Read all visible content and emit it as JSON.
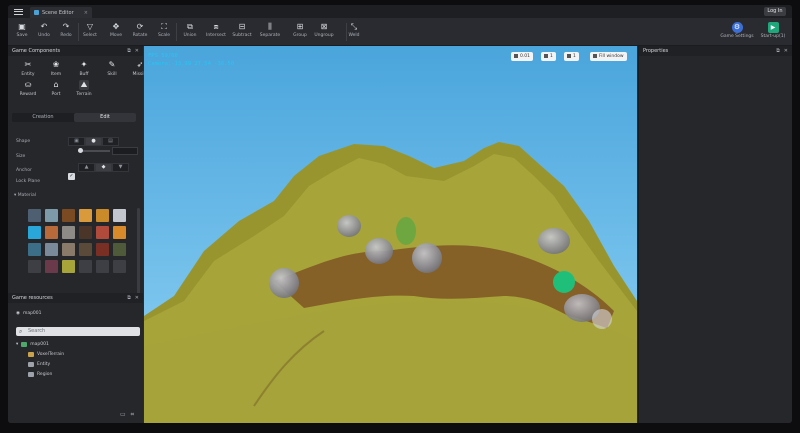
{
  "titlebar": {
    "tab_label": "Scene Editor",
    "tab_close": "×",
    "login_label": "Log In"
  },
  "toolbar": {
    "items": [
      {
        "name": "save-button",
        "icon": "save-icon",
        "glyph": "▣",
        "label": "Save"
      },
      {
        "name": "undo-button",
        "icon": "undo-icon",
        "glyph": "↶",
        "label": "Undo"
      },
      {
        "name": "redo-button",
        "icon": "redo-icon",
        "glyph": "↷",
        "label": "Redo"
      },
      {
        "name": "select-button",
        "icon": "select-icon",
        "glyph": "▽",
        "label": "Select"
      },
      {
        "name": "move-button",
        "icon": "move-icon",
        "glyph": "✥",
        "label": "Move"
      },
      {
        "name": "rotate-button",
        "icon": "rotate-icon",
        "glyph": "⟳",
        "label": "Rotate"
      },
      {
        "name": "scale-button",
        "icon": "scale-icon",
        "glyph": "⛶",
        "label": "Scale"
      },
      {
        "name": "union-button",
        "icon": "union-icon",
        "glyph": "⧉",
        "label": "Union"
      },
      {
        "name": "intersect-button",
        "icon": "intersect-icon",
        "glyph": "⧈",
        "label": "Intersect"
      },
      {
        "name": "subtract-button",
        "icon": "subtract-icon",
        "glyph": "⊟",
        "label": "Subtract"
      },
      {
        "name": "separate-button",
        "icon": "separate-icon",
        "glyph": "⫼",
        "label": "Separate"
      },
      {
        "name": "group-button",
        "icon": "group-icon",
        "glyph": "⊞",
        "label": "Group"
      },
      {
        "name": "ungroup-button",
        "icon": "ungroup-icon",
        "glyph": "⊠",
        "label": "Ungroup"
      },
      {
        "name": "weld-button",
        "icon": "weld-icon",
        "glyph": "⤡",
        "label": "Weld"
      }
    ],
    "game_settings": {
      "glyph": "⚙",
      "label": "Game Settings"
    },
    "startup": {
      "glyph": "▶",
      "label": "Start-up(1)"
    }
  },
  "components": {
    "title": "Game Components",
    "items": [
      {
        "name": "entity",
        "glyph": "✂",
        "label": "Entity"
      },
      {
        "name": "item",
        "glyph": "❀",
        "label": "Item"
      },
      {
        "name": "buff",
        "glyph": "✦",
        "label": "Buff"
      },
      {
        "name": "skill",
        "glyph": "✎",
        "label": "Skill"
      },
      {
        "name": "missile",
        "glyph": "➶",
        "label": "Missile"
      },
      {
        "name": "reward",
        "glyph": "⛀",
        "label": "Reward"
      },
      {
        "name": "port",
        "glyph": "⌂",
        "label": "Port"
      },
      {
        "name": "terrain",
        "glyph": "⛰",
        "label": "Terrain"
      }
    ],
    "tabs": [
      "Creation",
      "Edit"
    ],
    "shape_label": "Shape",
    "size_label": "Size",
    "anchor_label": "Anchor",
    "lock_plane_label": "Lock Plane",
    "material_label": "Material",
    "swatches": [
      "#4d5f70",
      "#7d9aa8",
      "#7a4a22",
      "#d89a3a",
      "#c98a2a",
      "#c4c7cd",
      "#2aa7d9",
      "#b86a3a",
      "#8e8a86",
      "#4a3528",
      "#b04a3a",
      "#d88a2a",
      "#3c6e88",
      "#7a8a9a",
      "#8a7a6a",
      "#5a4a3a",
      "#7a2f24",
      "#4f5a3a",
      "#3d3f45",
      "#6a3a4a",
      "#a7a43a",
      "#3d3f45",
      "#3d3f45",
      "#3d3f45"
    ]
  },
  "resources": {
    "title": "Game resources",
    "scene": "map001",
    "search_placeholder": "Search",
    "tree": [
      "map001",
      "VoxelTerrain",
      "Entity",
      "Region"
    ]
  },
  "viewport": {
    "fps": "FPS 59/60",
    "camera": "Camera:-13.99 27.54 -36.50",
    "controls": [
      "0.01",
      "1",
      "1",
      "Fill window"
    ],
    "colors": {
      "sky_top": "#4aa5dc",
      "sky_bottom": "#8fd2f5",
      "grass": "#a7a43a",
      "dirt": "#7a4a22",
      "rock": "#8e8f98",
      "marker": "#1fbf7a"
    }
  },
  "properties": {
    "title": "Properties"
  }
}
